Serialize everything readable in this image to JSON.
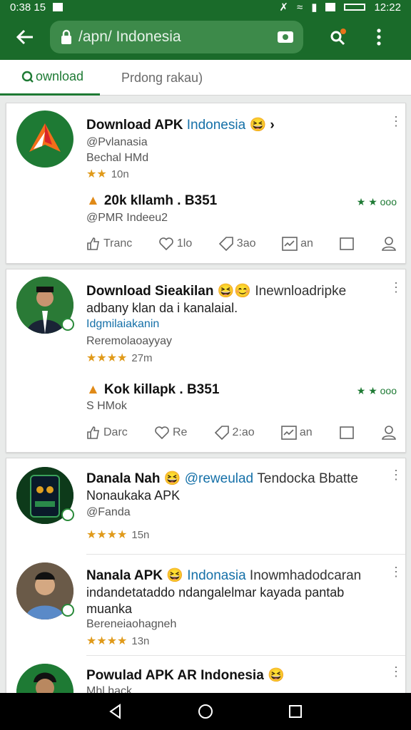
{
  "status": {
    "time_left": "0:38 15",
    "time_right": "12:22"
  },
  "toolbar": {
    "url": "/apn/ Indonesia"
  },
  "tabs": [
    {
      "label": "ownload"
    },
    {
      "label": "Prdong rakau)"
    }
  ],
  "posts": [
    {
      "title": "Download APK",
      "title_extra": "Indonesia",
      "emoji": "😆 ›",
      "handle": "@Pvlanasia",
      "subtitle": "Bechal HMd",
      "stars": "★★",
      "star_count": "10n",
      "stat": "20k kllamh . B351",
      "stat_sub": "@PMR Indeeu2",
      "rating_right": "★ ★ ooo",
      "actions": {
        "like": "Tranc",
        "heart": "1lo",
        "tag": "3ao",
        "chart": "an"
      }
    },
    {
      "title": "Download Sieakilan",
      "emoji": "😆😊",
      "extra": "Inewnloadripke",
      "line1": "adbany klan da i kanalaial.",
      "line2": "Idgmilaiakanin",
      "line3": "Reremolaoayyay",
      "stars": "★★★★",
      "star_count": "27m",
      "stat": "Kok killapk . B351",
      "stat_sub": "S HMok",
      "rating_right": "★ ★ ooo",
      "actions": {
        "like": "Darc",
        "heart": "Re",
        "tag": "2:ao",
        "chart": "an"
      }
    },
    {
      "title": "Danala Nah",
      "emoji": "😆",
      "extra": "@reweulad",
      "extra2": "Tendocka Bbatte",
      "line1": "Nonaukaka APK",
      "handle": "@Fanda",
      "stars": "★★★★",
      "star_count": "15n"
    },
    {
      "title": "Nanala APK",
      "emoji": "😆",
      "extra": "Indonasia",
      "extra2": "Inowmhadodcaran",
      "line1": "indandetataddo ndangalelmar kayada pantab",
      "line2": "muanka",
      "line3": "Bereneiaohagneh",
      "stars": "★★★★",
      "star_count": "13n"
    },
    {
      "title": "Powulad APK AR Indonesia",
      "emoji": "😆",
      "line1": "Mhl hack"
    }
  ],
  "colors": {
    "brand": "#1a6b2a",
    "accent": "#1e7a34",
    "link": "#1570a8",
    "star": "#e09a1a"
  }
}
